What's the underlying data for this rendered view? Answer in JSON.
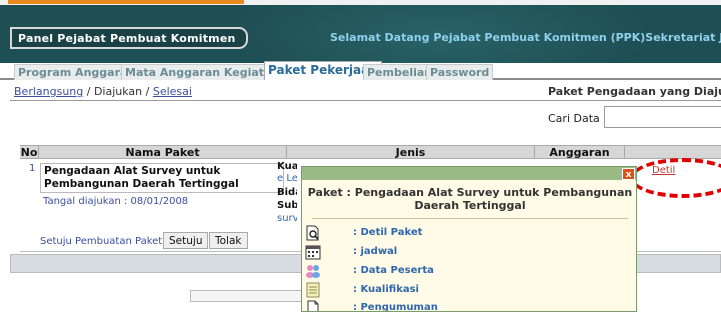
{
  "header": {
    "panel_title": "Panel Pejabat Pembuat Komitmen",
    "welcome": "Selamat Datang Pejabat Pembuat Komitmen (PPK)Sekretariat Jender"
  },
  "tabs": [
    {
      "label": "Program Anggaran",
      "active": false
    },
    {
      "label": "Mata Anggaran Kegiatan",
      "active": false
    },
    {
      "label": "Paket Pekerjaan",
      "active": true
    },
    {
      "label": "Pembelian",
      "active": false
    },
    {
      "label": "Password",
      "active": false
    }
  ],
  "breadcrumb": {
    "berlangsung": "Berlangsung",
    "sep1": " / ",
    "diajukan": "Diajukan",
    "sep2": " / ",
    "selesai": "Selesai"
  },
  "page_heading": "Paket Pengadaan yang Diajuka",
  "search": {
    "label": "Cari Data :",
    "value": ""
  },
  "table": {
    "columns": [
      "No",
      "Nama Paket",
      "Jenis",
      "Anggaran"
    ],
    "row": {
      "no": "1",
      "nama_paket": "Pengadaan Alat Survey untuk Pembangunan Daerah Tertinggal",
      "tanggal": "Tangal diajukan : 08/01/2008",
      "jenis_fragments": [
        "Kual",
        "e Le",
        "Bida",
        "Sub",
        "surv"
      ],
      "setuju_question": "Setuju Pembuatan Paket ?",
      "setuju_button": "Setuju",
      "tolak_button": "Tolak",
      "detil_link": "Detil"
    }
  },
  "popup": {
    "title": "Paket : Pengadaan Alat Survey untuk Pembangunan Daerah Tertinggal",
    "close_label": "x",
    "menu": [
      {
        "label": ": Detil Paket",
        "icon": "document-search-icon"
      },
      {
        "label": ": jadwal",
        "icon": "calendar-icon"
      },
      {
        "label": ": Data Peserta",
        "icon": "users-icon"
      },
      {
        "label": ": Kualifikasi",
        "icon": "document-list-icon"
      },
      {
        "label": ": Pengumuman",
        "icon": "document-icon"
      }
    ]
  },
  "colors": {
    "banner": "#1e4f54",
    "accent_orange": "#e8891d",
    "highlight_ring": "#e10000",
    "popup_header": "#9bbb86"
  }
}
